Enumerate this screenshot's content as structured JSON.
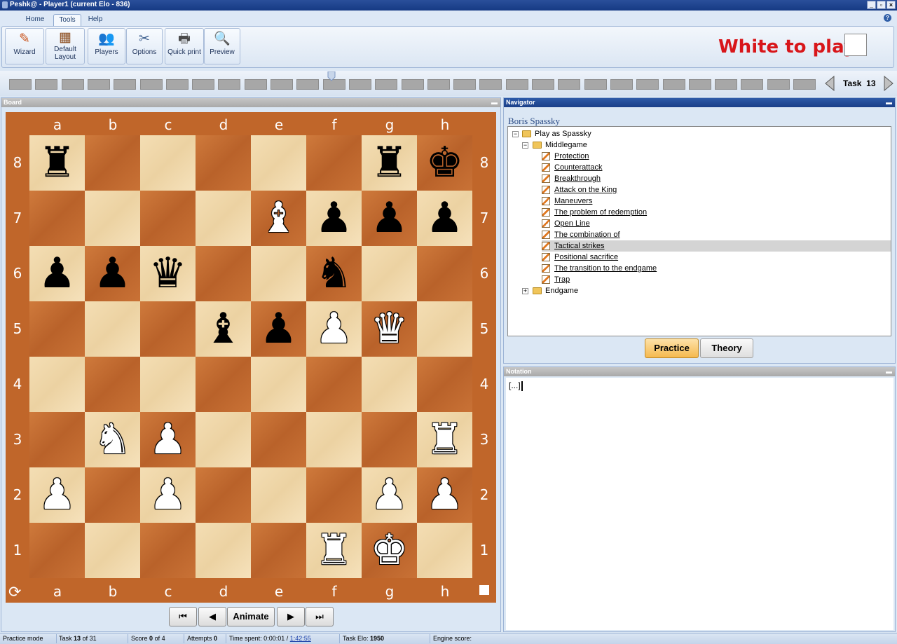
{
  "window": {
    "title": "Peshk@ - Player1 (current Elo - 836)"
  },
  "ribbon": {
    "tabs": [
      "Home",
      "Tools",
      "Help"
    ],
    "active_tab": "Tools",
    "buttons": {
      "wizard": "Wizard",
      "default_layout_1": "Default",
      "default_layout_2": "Layout",
      "players": "Players",
      "options": "Options",
      "quick_print": "Quick print",
      "preview": "Preview"
    },
    "to_play": "White to play",
    "to_play_color": "#d8161a"
  },
  "taskstrip": {
    "task_label": "Task",
    "task_number": "13"
  },
  "board_panel": {
    "title": "Board"
  },
  "board": {
    "files": [
      "a",
      "b",
      "c",
      "d",
      "e",
      "f",
      "g",
      "h"
    ],
    "ranks": [
      "8",
      "7",
      "6",
      "5",
      "4",
      "3",
      "2",
      "1"
    ],
    "pieces": [
      {
        "square": "a8",
        "color": "b",
        "type": "rook"
      },
      {
        "square": "g8",
        "color": "b",
        "type": "rook"
      },
      {
        "square": "h8",
        "color": "b",
        "type": "king"
      },
      {
        "square": "e7",
        "color": "w",
        "type": "bishop"
      },
      {
        "square": "f7",
        "color": "b",
        "type": "pawn"
      },
      {
        "square": "g7",
        "color": "b",
        "type": "pawn"
      },
      {
        "square": "h7",
        "color": "b",
        "type": "pawn"
      },
      {
        "square": "a6",
        "color": "b",
        "type": "pawn"
      },
      {
        "square": "b6",
        "color": "b",
        "type": "pawn"
      },
      {
        "square": "c6",
        "color": "b",
        "type": "queen"
      },
      {
        "square": "f6",
        "color": "b",
        "type": "knight"
      },
      {
        "square": "d5",
        "color": "b",
        "type": "bishop"
      },
      {
        "square": "e5",
        "color": "b",
        "type": "pawn"
      },
      {
        "square": "f5",
        "color": "w",
        "type": "pawn"
      },
      {
        "square": "g5",
        "color": "w",
        "type": "queen"
      },
      {
        "square": "b3",
        "color": "w",
        "type": "knight"
      },
      {
        "square": "c3",
        "color": "w",
        "type": "pawn"
      },
      {
        "square": "h3",
        "color": "w",
        "type": "rook"
      },
      {
        "square": "a2",
        "color": "w",
        "type": "pawn"
      },
      {
        "square": "c2",
        "color": "w",
        "type": "pawn"
      },
      {
        "square": "g2",
        "color": "w",
        "type": "pawn"
      },
      {
        "square": "h2",
        "color": "w",
        "type": "pawn"
      },
      {
        "square": "f1",
        "color": "w",
        "type": "rook"
      },
      {
        "square": "g1",
        "color": "w",
        "type": "king"
      }
    ],
    "controls": {
      "animate": "Animate"
    }
  },
  "navigator": {
    "title": "Navigator",
    "user": "Boris Spassky",
    "root": "Play as Spassky",
    "group_middlegame": "Middlegame",
    "items": [
      "Protection",
      "Counterattack",
      "Breakthrough",
      "Attack on the King",
      "Maneuvers",
      "The problem of redemption",
      "Open Line",
      "The combination of",
      "Tactical strikes",
      "Positional sacrifice",
      "The transition to the endgame",
      "Trap"
    ],
    "selected_item": "Tactical strikes",
    "group_endgame": "Endgame",
    "practice": "Practice",
    "theory": "Theory",
    "practice_color": "#f7c267"
  },
  "notation": {
    "title": "Notation",
    "text": "[...]"
  },
  "statusbar": {
    "mode": "Practice mode",
    "task_prefix": "Task",
    "task_num": "13",
    "task_of": "of 31",
    "score_prefix": "Score",
    "score_num": "0",
    "score_of": "of 4",
    "attempts_prefix": "Attempts",
    "attempts_num": "0",
    "time_prefix": "Time spent: 0:00:01 /",
    "time_total": "1:42:55",
    "elo_prefix": "Task Elo:",
    "elo_num": "1950",
    "engine": "Engine score:"
  }
}
